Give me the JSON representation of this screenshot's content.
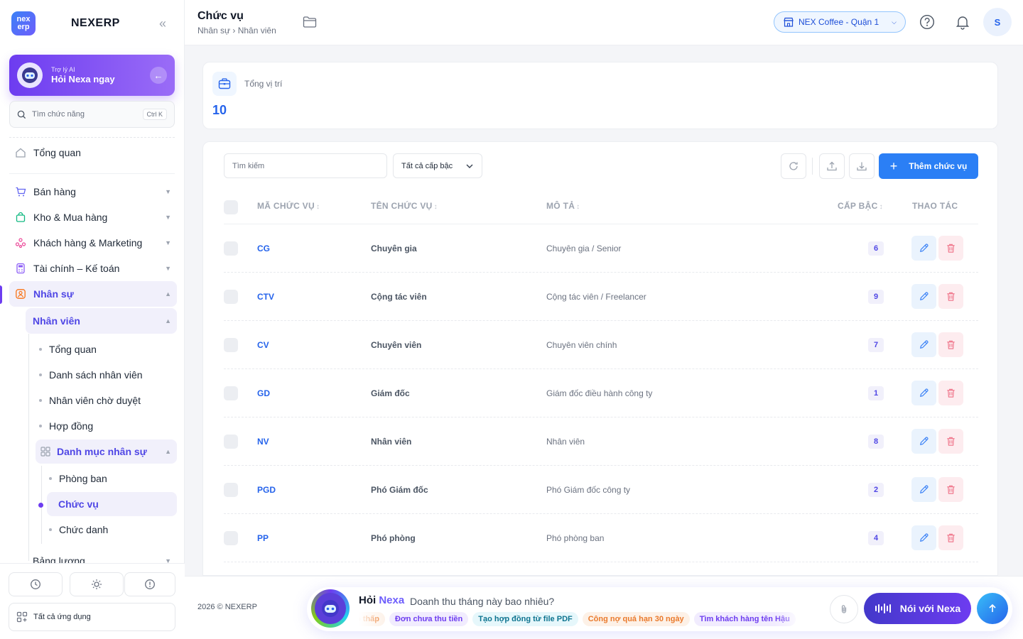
{
  "brand": {
    "logo_line1": "nex",
    "logo_line2": "erp",
    "name": "NEXERP",
    "collapse_icon": "double-chevron-left-icon"
  },
  "ai_card": {
    "subtitle": "Trợ lý AI",
    "title": "Hỏi Nexa ngay"
  },
  "side_search": {
    "placeholder": "Tìm chức năng",
    "shortcut": "Ctrl K"
  },
  "nav": {
    "overview": "Tổng quan",
    "sales": "Bán hàng",
    "inventory": "Kho & Mua hàng",
    "customers": "Khách hàng & Marketing",
    "finance": "Tài chính – Kế toán",
    "hr": "Nhân sự",
    "employees": "Nhân viên",
    "emp_overview": "Tổng quan",
    "emp_list": "Danh sách nhân viên",
    "emp_pending": "Nhân viên chờ duyệt",
    "contracts": "Hợp đồng",
    "hr_catalog": "Danh mục nhân sự",
    "departments": "Phòng ban",
    "positions": "Chức vụ",
    "titles": "Chức danh",
    "payroll": "Bảng lương"
  },
  "side_bottom": {
    "all_apps": "Tất cả ứng dụng"
  },
  "header": {
    "title": "Chức vụ",
    "breadcrumb": "Nhân sự › Nhân viên",
    "store": "NEX Coffee - Quận 1",
    "user_initial": "S"
  },
  "stats": {
    "label": "Tổng vị trí",
    "value": "10"
  },
  "toolbar": {
    "search_placeholder": "Tìm kiếm",
    "filter_label": "Tất cả cấp bậc",
    "add_label": "Thêm chức vụ"
  },
  "table": {
    "columns": {
      "code": "MÃ CHỨC VỤ",
      "name": "TÊN CHỨC VỤ",
      "desc": "MÔ TẢ",
      "level": "CẤP BẬC",
      "actions": "THAO TÁC"
    },
    "sort_glyph": "↕",
    "rows": [
      {
        "code": "CG",
        "name": "Chuyên gia",
        "desc": "Chuyên gia / Senior",
        "level": "6"
      },
      {
        "code": "CTV",
        "name": "Cộng tác viên",
        "desc": "Cộng tác viên / Freelancer",
        "level": "9"
      },
      {
        "code": "CV",
        "name": "Chuyên viên",
        "desc": "Chuyên viên chính",
        "level": "7"
      },
      {
        "code": "GD",
        "name": "Giám đốc",
        "desc": "Giám đốc điều hành công ty",
        "level": "1"
      },
      {
        "code": "NV",
        "name": "Nhân viên",
        "desc": "Nhân viên",
        "level": "8"
      },
      {
        "code": "PGD",
        "name": "Phó Giám đốc",
        "desc": "Phó Giám đốc công ty",
        "level": "2"
      },
      {
        "code": "PP",
        "name": "Phó phòng",
        "desc": "Phó phòng ban",
        "level": "4"
      }
    ]
  },
  "footer": {
    "copyright": "2026 © NEXERP",
    "nexa_title_prefix": "Hỏi ",
    "nexa_title_brand": "Nexa",
    "nexa_question": "Doanh thu tháng này bao nhiêu?",
    "chips": [
      {
        "label": "o thấp",
        "bg": "#fdf1e7",
        "fg": "#ea7a2c"
      },
      {
        "label": "Đơn chưa thu tiền",
        "bg": "#f1ecfe",
        "fg": "#6d3cf0"
      },
      {
        "label": "Tạo hợp đồng từ file PDF",
        "bg": "#e6f7fb",
        "fg": "#0e7490"
      },
      {
        "label": "Công nợ quá hạn 30 ngày",
        "bg": "#fdf1e7",
        "fg": "#ea7a2c"
      },
      {
        "label": "Tìm khách hàng tên Hậu",
        "bg": "#f1ecfe",
        "fg": "#6d3cf0"
      }
    ],
    "voice_label": "Nói với Nexa"
  },
  "colors": {
    "accent": "#2b7ff5",
    "primary_purple": "#6d3cf0",
    "danger": "#f07a8f"
  }
}
